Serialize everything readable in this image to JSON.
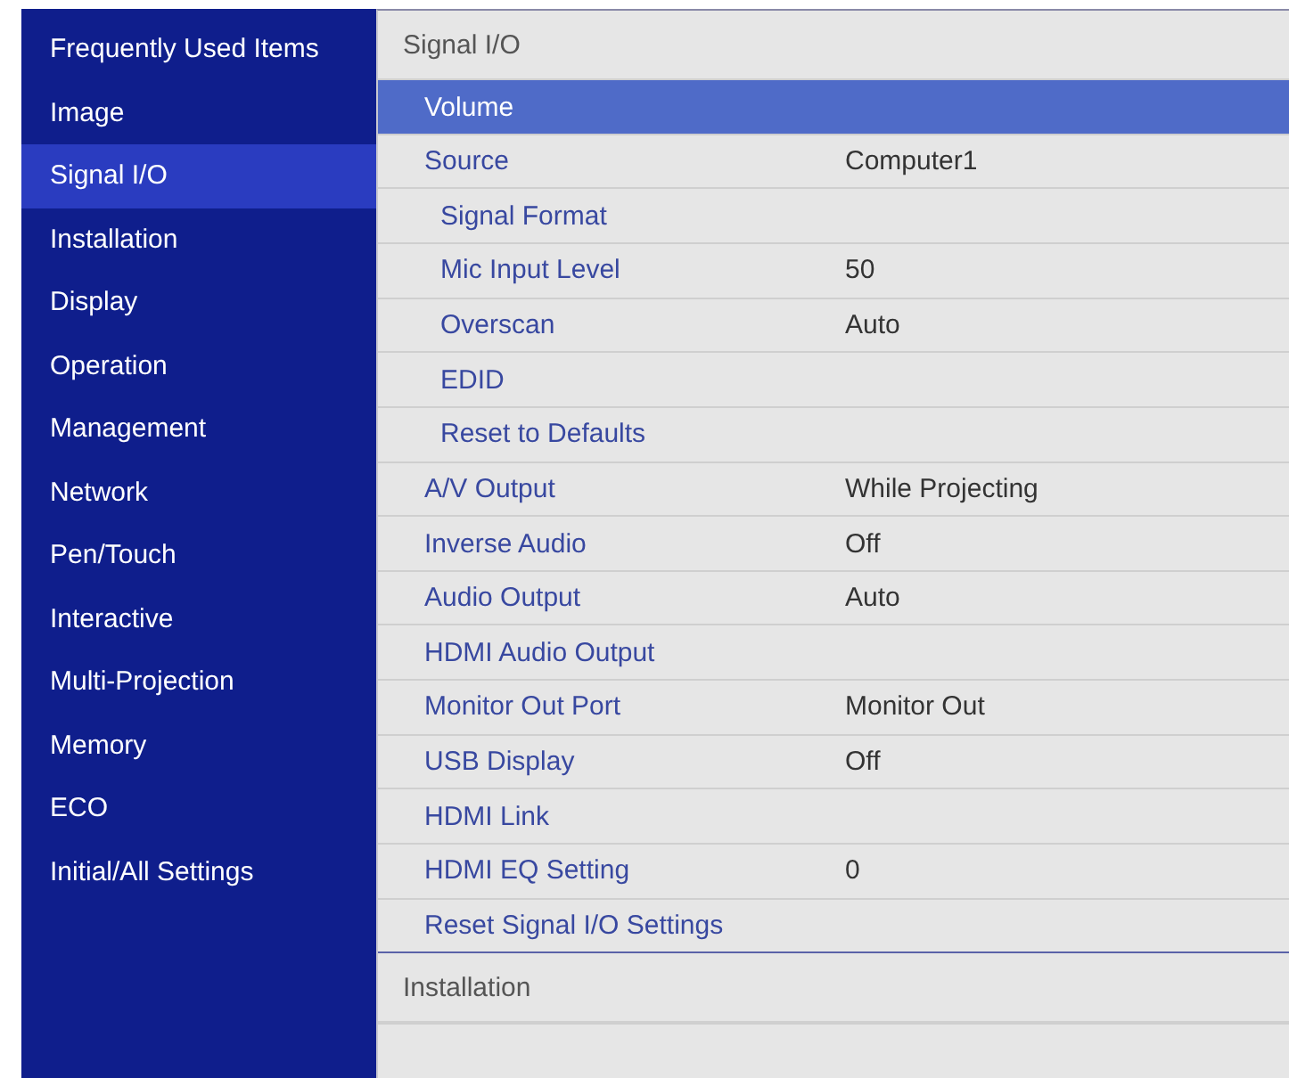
{
  "sidebar": {
    "items": [
      {
        "label": "Frequently Used Items",
        "selected": false
      },
      {
        "label": "Image",
        "selected": false
      },
      {
        "label": "Signal I/O",
        "selected": true
      },
      {
        "label": "Installation",
        "selected": false
      },
      {
        "label": "Display",
        "selected": false
      },
      {
        "label": "Operation",
        "selected": false
      },
      {
        "label": "Management",
        "selected": false
      },
      {
        "label": "Network",
        "selected": false
      },
      {
        "label": "Pen/Touch",
        "selected": false
      },
      {
        "label": "Interactive",
        "selected": false
      },
      {
        "label": "Multi-Projection",
        "selected": false
      },
      {
        "label": "Memory",
        "selected": false
      },
      {
        "label": "ECO",
        "selected": false
      },
      {
        "label": "Initial/All Settings",
        "selected": false
      }
    ]
  },
  "sections": [
    {
      "title": "Signal I/O",
      "items": [
        {
          "label": "Volume",
          "selected": true
        },
        {
          "label": "Source",
          "value": "Computer1",
          "selected": false,
          "children": [
            {
              "label": "Signal Format",
              "selected": false
            },
            {
              "label": "Mic Input Level",
              "value": "50",
              "selected": false
            },
            {
              "label": "Overscan",
              "value": "Auto",
              "selected": false
            },
            {
              "label": "EDID",
              "selected": false
            },
            {
              "label": "Reset to Defaults",
              "selected": false
            }
          ]
        },
        {
          "label": "A/V Output",
          "value": "While Projecting",
          "selected": false
        },
        {
          "label": "Inverse Audio",
          "value": "Off",
          "selected": false
        },
        {
          "label": "Audio Output",
          "value": "Auto",
          "selected": false
        },
        {
          "label": "HDMI Audio Output",
          "selected": false
        },
        {
          "label": "Monitor Out Port",
          "value": "Monitor Out",
          "selected": false
        },
        {
          "label": "USB Display",
          "value": "Off",
          "selected": false
        },
        {
          "label": "HDMI Link",
          "selected": false
        },
        {
          "label": "HDMI EQ Setting",
          "value": "0",
          "selected": false
        },
        {
          "label": "Reset Signal I/O Settings",
          "selected": false
        }
      ]
    },
    {
      "title": "Installation"
    }
  ]
}
